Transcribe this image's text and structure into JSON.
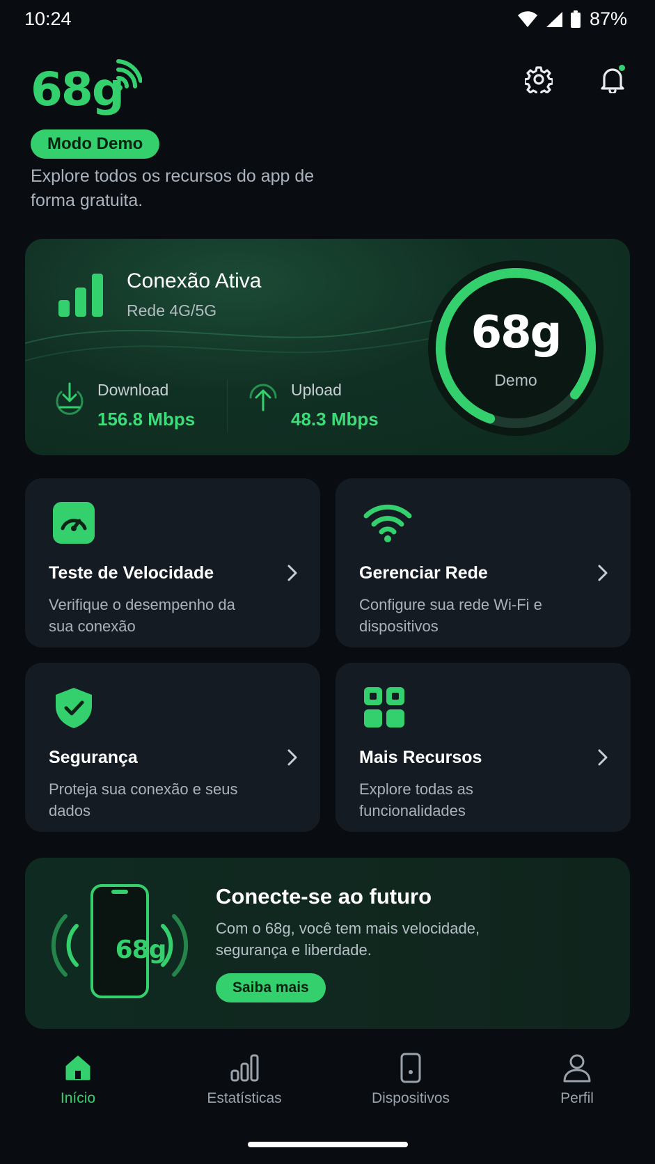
{
  "status_bar": {
    "time": "10:24",
    "battery": "87%"
  },
  "header": {
    "logo_text": "68g",
    "badge": "Modo Demo",
    "subtitle": "Explore todos os recursos do app de forma gratuita."
  },
  "connection": {
    "title": "Conexão Ativa",
    "subtitle": "Rede 4G/5G",
    "download_label": "Download",
    "download_value": "156.8 Mbps",
    "upload_label": "Upload",
    "upload_value": "48.3 Mbps",
    "gauge_value": "68g",
    "gauge_label": "Demo",
    "gauge_fill": 0.8
  },
  "features": [
    {
      "title": "Teste de Velocidade",
      "description": "Verifique o desempenho da sua conexão",
      "icon": "speedometer-icon"
    },
    {
      "title": "Gerenciar Rede",
      "description": "Configure sua rede Wi-Fi e dispositivos",
      "icon": "wifi-icon"
    },
    {
      "title": "Segurança",
      "description": "Proteja sua conexão e seus dados",
      "icon": "shield-check-icon"
    },
    {
      "title": "Mais Recursos",
      "description": "Explore todas as funcionalidades",
      "icon": "grid-icon"
    }
  ],
  "promo": {
    "phone_text": "68g",
    "title": "Conecte-se ao futuro",
    "text": "Com o 68g, você tem mais velocidade, segurança e liberdade.",
    "button": "Saiba mais"
  },
  "nav": [
    {
      "label": "Início",
      "icon": "home-icon",
      "active": true
    },
    {
      "label": "Estatísticas",
      "icon": "bar-chart-icon",
      "active": false
    },
    {
      "label": "Dispositivos",
      "icon": "device-icon",
      "active": false
    },
    {
      "label": "Perfil",
      "icon": "user-icon",
      "active": false
    }
  ],
  "colors": {
    "accent": "#35d06e",
    "background": "#090d11",
    "card": "#151b23"
  }
}
